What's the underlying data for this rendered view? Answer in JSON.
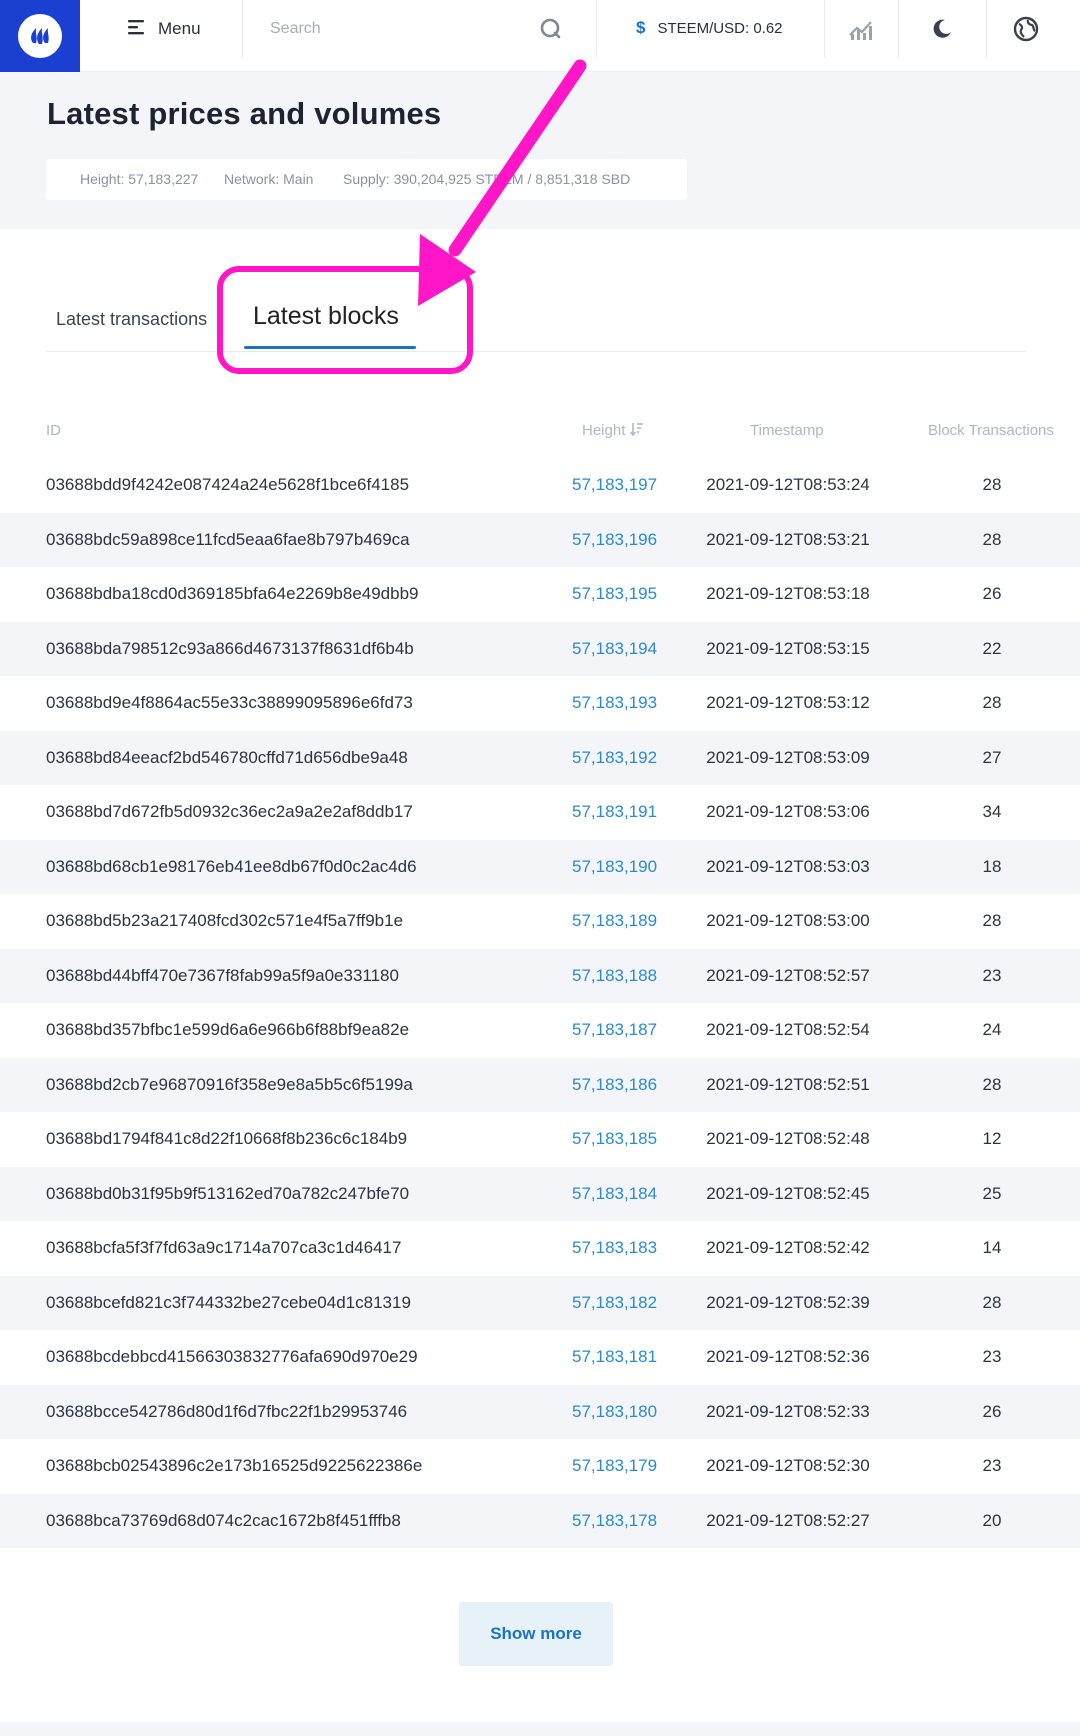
{
  "topbar": {
    "menu_label": "Menu",
    "search_placeholder": "Search",
    "price_symbol": "$",
    "price_text": "STEEM/USD: 0.62",
    "icons": [
      "steem-logo-icon",
      "hamburger-icon",
      "search-icon",
      "chart-icon",
      "moon-icon",
      "globe-icon"
    ]
  },
  "header": {
    "title": "Latest prices and volumes",
    "height": "Height: 57,183,227",
    "network": "Network: Main",
    "supply": "Supply: 390,204,925 STEEM / 8,851,318 SBD"
  },
  "tabs": {
    "transactions": "Latest transactions",
    "blocks": "Latest blocks",
    "active": "blocks"
  },
  "table": {
    "columns": {
      "id": "ID",
      "height": "Height",
      "timestamp": "Timestamp",
      "transactions": "Block Transactions"
    },
    "rows": [
      {
        "id": "03688bdd9f4242e087424a24e5628f1bce6f4185",
        "height": "57,183,197",
        "timestamp": "2021-09-12T08:53:24",
        "tx": "28"
      },
      {
        "id": "03688bdc59a898ce11fcd5eaa6fae8b797b469ca",
        "height": "57,183,196",
        "timestamp": "2021-09-12T08:53:21",
        "tx": "28"
      },
      {
        "id": "03688bdba18cd0d369185bfa64e2269b8e49dbb9",
        "height": "57,183,195",
        "timestamp": "2021-09-12T08:53:18",
        "tx": "26"
      },
      {
        "id": "03688bda798512c93a866d4673137f8631df6b4b",
        "height": "57,183,194",
        "timestamp": "2021-09-12T08:53:15",
        "tx": "22"
      },
      {
        "id": "03688bd9e4f8864ac55e33c38899095896e6fd73",
        "height": "57,183,193",
        "timestamp": "2021-09-12T08:53:12",
        "tx": "28"
      },
      {
        "id": "03688bd84eeacf2bd546780cffd71d656dbe9a48",
        "height": "57,183,192",
        "timestamp": "2021-09-12T08:53:09",
        "tx": "27"
      },
      {
        "id": "03688bd7d672fb5d0932c36ec2a9a2e2af8ddb17",
        "height": "57,183,191",
        "timestamp": "2021-09-12T08:53:06",
        "tx": "34"
      },
      {
        "id": "03688bd68cb1e98176eb41ee8db67f0d0c2ac4d6",
        "height": "57,183,190",
        "timestamp": "2021-09-12T08:53:03",
        "tx": "18"
      },
      {
        "id": "03688bd5b23a217408fcd302c571e4f5a7ff9b1e",
        "height": "57,183,189",
        "timestamp": "2021-09-12T08:53:00",
        "tx": "28"
      },
      {
        "id": "03688bd44bff470e7367f8fab99a5f9a0e331180",
        "height": "57,183,188",
        "timestamp": "2021-09-12T08:52:57",
        "tx": "23"
      },
      {
        "id": "03688bd357bfbc1e599d6a6e966b6f88bf9ea82e",
        "height": "57,183,187",
        "timestamp": "2021-09-12T08:52:54",
        "tx": "24"
      },
      {
        "id": "03688bd2cb7e96870916f358e9e8a5b5c6f5199a",
        "height": "57,183,186",
        "timestamp": "2021-09-12T08:52:51",
        "tx": "28"
      },
      {
        "id": "03688bd1794f841c8d22f10668f8b236c6c184b9",
        "height": "57,183,185",
        "timestamp": "2021-09-12T08:52:48",
        "tx": "12"
      },
      {
        "id": "03688bd0b31f95b9f513162ed70a782c247bfe70",
        "height": "57,183,184",
        "timestamp": "2021-09-12T08:52:45",
        "tx": "25"
      },
      {
        "id": "03688bcfa5f3f7fd63a9c1714a707ca3c1d46417",
        "height": "57,183,183",
        "timestamp": "2021-09-12T08:52:42",
        "tx": "14"
      },
      {
        "id": "03688bcefd821c3f744332be27cebe04d1c81319",
        "height": "57,183,182",
        "timestamp": "2021-09-12T08:52:39",
        "tx": "28"
      },
      {
        "id": "03688bcdebbcd41566303832776afa690d970e29",
        "height": "57,183,181",
        "timestamp": "2021-09-12T08:52:36",
        "tx": "23"
      },
      {
        "id": "03688bcce542786d80d1f6d7fbc22f1b29953746",
        "height": "57,183,180",
        "timestamp": "2021-09-12T08:52:33",
        "tx": "26"
      },
      {
        "id": "03688bcb02543896c2e173b16525d9225622386e",
        "height": "57,183,179",
        "timestamp": "2021-09-12T08:52:30",
        "tx": "23"
      },
      {
        "id": "03688bca73769d68d074c2cac1672b8f451fffb8",
        "height": "57,183,178",
        "timestamp": "2021-09-12T08:52:27",
        "tx": "20"
      }
    ]
  },
  "show_more_label": "Show more",
  "colors": {
    "brand": "#1a3fd1",
    "link": "#2a8bd0",
    "annotation": "#ff17c7",
    "alt_row": "#f4f5f8"
  }
}
